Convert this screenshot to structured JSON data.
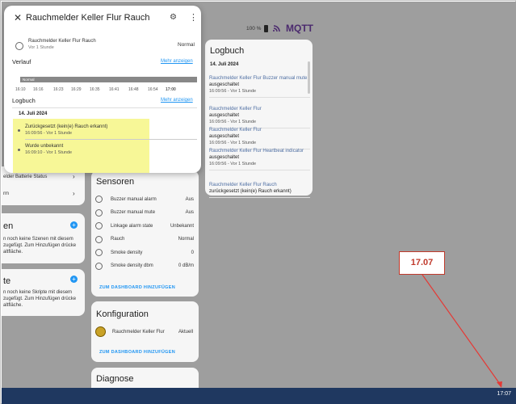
{
  "dialog": {
    "title": "Rauchmelder Keller Flur Rauch",
    "entity_name": "Rauchmelder Keller Flur Rauch",
    "entity_age": "Vor 1 Stunde",
    "entity_state": "Normal",
    "history_label": "Verlauf",
    "show_more": "Mehr anzeigen",
    "timeline_state": "Normal",
    "ticks": [
      "16:10",
      "16:16",
      "16:23",
      "16:29",
      "16:35",
      "16:41",
      "16:48",
      "16:54",
      "17:00"
    ],
    "logbook_label": "Logbuch",
    "logbook_show_more": "Mehr anzeigen",
    "logbook_date": "14. Juli 2024",
    "entries": [
      {
        "text": "Zurückgesetzt (kein(e) Rauch erkannt)",
        "time": "16:09:56 - Vor 1 Stunde"
      },
      {
        "text": "Wurde unbekannt",
        "time": "16:09:10 - Vor 1 Stunde"
      }
    ]
  },
  "status": {
    "battery": "100 %",
    "brand": "MQTT"
  },
  "logbuch_card": {
    "title": "Logbuch",
    "date": "14. Juli 2024",
    "entries": [
      {
        "name": "Rauchmelder Keller Flur Buzzer manual mute",
        "action": "ausgeschaltet",
        "time": "16:09:56 - Vor 1 Stunde"
      },
      {
        "name": "Rauchmelder Keller Flur",
        "action": "ausgeschaltet",
        "time": "16:09:56 - Vor 1 Stunde"
      },
      {
        "name": "Rauchmelder Keller Flur",
        "action": "ausgeschaltet",
        "time": "16:09:56 - Vor 1 Stunde"
      },
      {
        "name": "Rauchmelder Keller Flur Heartbeat indicator",
        "action": "ausgeschaltet",
        "time": "16:09:56 - Vor 1 Stunde"
      },
      {
        "name": "Rauchmelder Keller Flur Rauch",
        "action": "zurückgesetzt (kein(e) Rauch erkannt)",
        "time": ""
      }
    ]
  },
  "sensoren": {
    "title": "Sensoren",
    "rows": [
      {
        "label": "Buzzer manual alarm",
        "value": "Aus"
      },
      {
        "label": "Buzzer manual mute",
        "value": "Aus"
      },
      {
        "label": "Linkage alarm state",
        "value": "Unbekannt"
      },
      {
        "label": "Rauch",
        "value": "Normal"
      },
      {
        "label": "Smoke density",
        "value": "0"
      },
      {
        "label": "Smoke density dbm",
        "value": "0 dB/m"
      }
    ],
    "add_dashboard": "ZUM DASHBOARD HINZUFÜGEN"
  },
  "konfiguration": {
    "title": "Konfiguration",
    "item_label": "Rauchmelder Keller Flur",
    "item_value": "Aktuell",
    "add_dashboard": "ZUM DASHBOARD HINZUFÜGEN"
  },
  "diagnose": {
    "title": "Diagnose"
  },
  "left": {
    "battery_row": "elder Batterie Status",
    "rm_row": "rm",
    "szenen_title": "en",
    "szenen_text": "n noch keine Szenen mit diesem zugefügt. Zum Hinzufügen drücke altfläche.",
    "skripte_title": "te",
    "skripte_text": "n noch keine Skripte mit diesem zugefügt. Zum Hinzufügen drücke altfläche."
  },
  "annotation": {
    "label": "17.07"
  },
  "taskbar": {
    "time": "17:07"
  }
}
